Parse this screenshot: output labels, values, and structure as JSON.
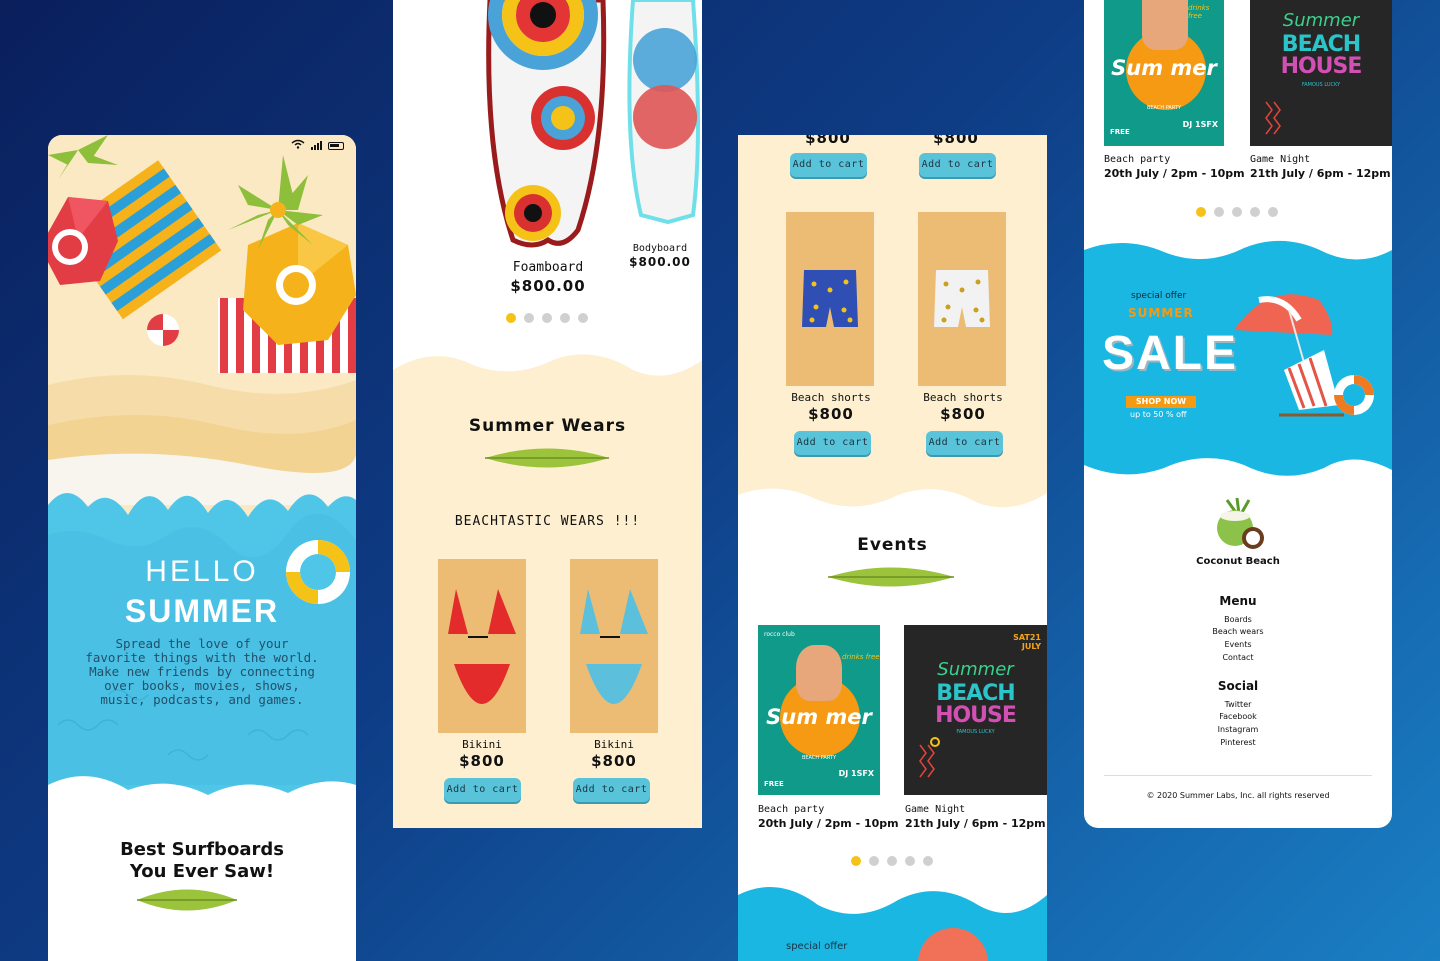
{
  "colors": {
    "accent": "#58c3d9",
    "dot_active": "#f5c317",
    "sand": "#fbe9c3",
    "card": "#edbc74",
    "sea": "#4fc6e8"
  },
  "phone1": {
    "hello": "HELLO",
    "summer": "SUMMER",
    "tagline": "Spread the love of your favorite things with the world. Make new friends by connecting over books, movies, shows, music, podcasts, and games.",
    "heading_line1": "Best Surfboards",
    "heading_line2": "You Ever Saw!"
  },
  "phone2": {
    "boards": [
      {
        "name": "Foamboard",
        "price": "$800.00"
      },
      {
        "name": "Bodyboard",
        "price": "$800.00"
      }
    ],
    "section_title": "Summer Wears",
    "tagline": "BEACHTASTIC WEARS !!!",
    "products": [
      {
        "name": "Bikini",
        "price": "$800",
        "button": "Add to cart"
      },
      {
        "name": "Bikini",
        "price": "$800",
        "button": "Add to cart"
      }
    ]
  },
  "phone3": {
    "top_prices": [
      "$800",
      "$800"
    ],
    "top_buttons": [
      "Add to cart",
      "Add to cart"
    ],
    "products": [
      {
        "name": "Beach shorts",
        "price": "$800",
        "button": "Add to cart"
      },
      {
        "name": "Beach shorts",
        "price": "$800",
        "button": "Add to cart"
      }
    ],
    "events_title": "Events",
    "events": [
      {
        "name": "Beach party",
        "date": "20th July /  2pm - 10pm"
      },
      {
        "name": "Game Night",
        "date": "21th July /  6pm - 12pm"
      }
    ],
    "promo_label": "special offer"
  },
  "phone4": {
    "events": [
      {
        "name": "Beach party",
        "date": "20th July /  2pm - 10pm"
      },
      {
        "name": "Game Night",
        "date": "21th July /  6pm - 12pm"
      }
    ],
    "promo": {
      "special": "special offer",
      "summer": "SUMMER",
      "sale": "SALE",
      "shop": "SHOP NOW",
      "off": "up to 50 % off"
    },
    "brand": "Coconut Beach",
    "menu_title": "Menu",
    "menu": [
      "Boards",
      "Beach wears",
      "Events",
      "Contact"
    ],
    "social_title": "Social",
    "social": [
      "Twitter",
      "Facebook",
      "Instagram",
      "Pinterest"
    ],
    "copyright": "© 2020 Summer Labs, Inc. all rights reserved"
  },
  "posters": {
    "party": {
      "brand": "rocco club",
      "drinks": "drinks free",
      "title": "Sum mer",
      "sub": "BEACH PARTY",
      "dj": "DJ 1SFX",
      "free": "FREE"
    },
    "beach": {
      "script": "Summer",
      "line1": "BEACH",
      "line2": "HOUSE",
      "date": "SAT21 JULY",
      "sub": "FAMOUS LUCKY"
    }
  }
}
